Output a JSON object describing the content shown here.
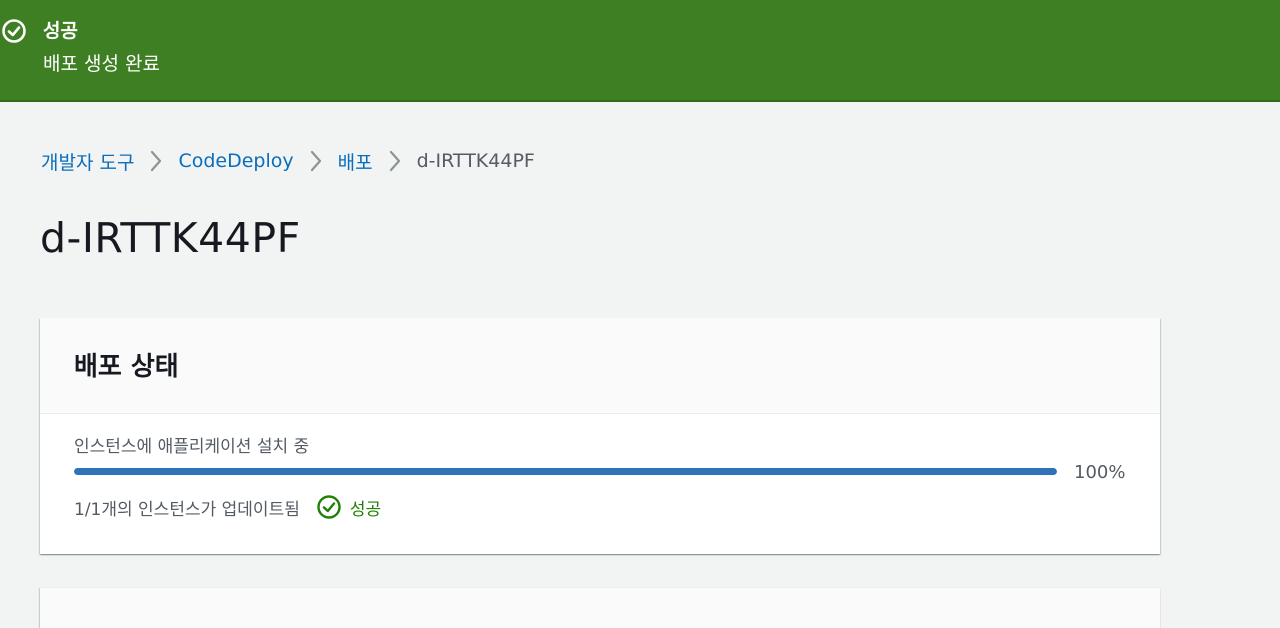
{
  "flash": {
    "type": "success",
    "icon": "check-circle-icon",
    "title": "성공",
    "message": "배포 생성 완료",
    "color": "#3d7f22"
  },
  "breadcrumb": {
    "items": [
      {
        "label": "개발자 도구",
        "link": true
      },
      {
        "label": "CodeDeploy",
        "link": true
      },
      {
        "label": "배포",
        "link": true
      },
      {
        "label": "d-IRTTK44PF",
        "link": false
      }
    ],
    "separator_icon": "chevron-right-icon"
  },
  "page": {
    "title": "d-IRTTK44PF"
  },
  "deployment_status": {
    "title": "배포 상태",
    "progress_label": "인스턴스에 애플리케이션 설치 중",
    "progress_percent": 100,
    "progress_text": "100%",
    "instances_updated": "1/1개의 인스턴스가 업데이트됨",
    "status_icon": "check-circle-icon",
    "status_text": "성공",
    "status_color": "#1d8102",
    "progress_color": "#2e73b8"
  }
}
